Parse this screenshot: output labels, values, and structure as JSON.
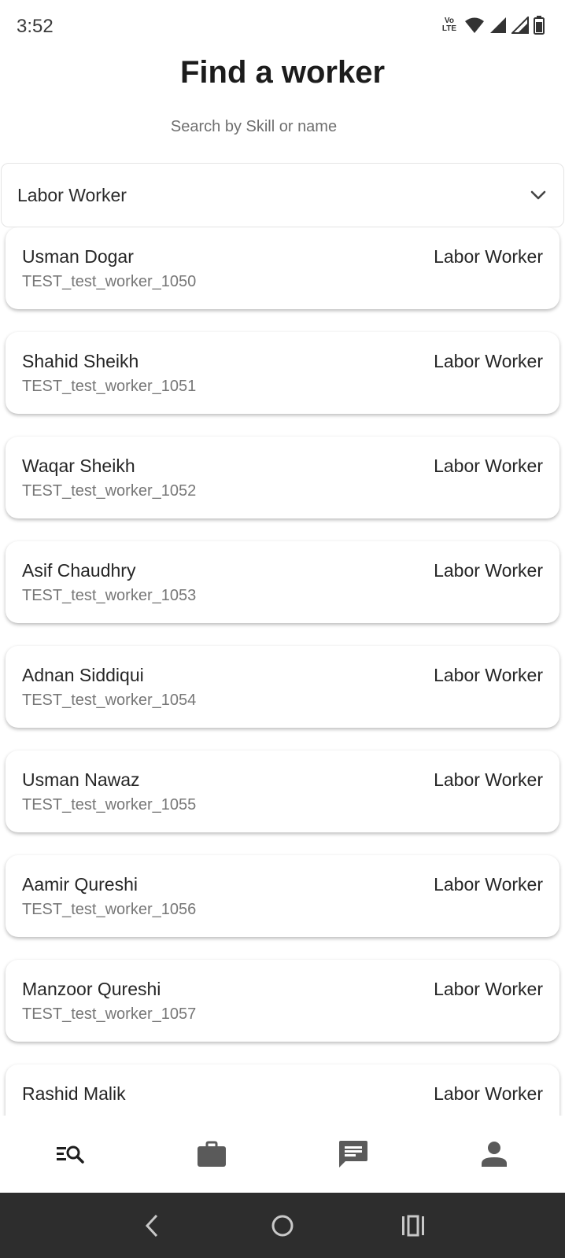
{
  "status_bar": {
    "time": "3:52",
    "volte_top": "Vo",
    "volte_bottom": "LTE",
    "icons": [
      "volte-icon",
      "wifi-icon",
      "signal-icon",
      "signal-icon",
      "battery-icon"
    ]
  },
  "header": {
    "title": "Find a worker",
    "search_hint": "Search by Skill or name"
  },
  "filter": {
    "selected": "Labor Worker",
    "icon": "chevron-down-icon"
  },
  "workers": [
    {
      "name": "Usman Dogar",
      "id": "TEST_test_worker_1050",
      "skill": "Labor Worker"
    },
    {
      "name": "Shahid Sheikh",
      "id": "TEST_test_worker_1051",
      "skill": "Labor Worker"
    },
    {
      "name": "Waqar Sheikh",
      "id": "TEST_test_worker_1052",
      "skill": "Labor Worker"
    },
    {
      "name": "Asif Chaudhry",
      "id": "TEST_test_worker_1053",
      "skill": "Labor Worker"
    },
    {
      "name": "Adnan Siddiqui",
      "id": "TEST_test_worker_1054",
      "skill": "Labor Worker"
    },
    {
      "name": "Usman Nawaz",
      "id": "TEST_test_worker_1055",
      "skill": "Labor Worker"
    },
    {
      "name": "Aamir Qureshi",
      "id": "TEST_test_worker_1056",
      "skill": "Labor Worker"
    },
    {
      "name": "Manzoor Qureshi",
      "id": "TEST_test_worker_1057",
      "skill": "Labor Worker"
    },
    {
      "name": "Rashid Malik",
      "id": "",
      "skill": "Labor Worker"
    }
  ],
  "bottom_nav": {
    "items": [
      {
        "icon": "search-list-icon",
        "active": true
      },
      {
        "icon": "briefcase-icon",
        "active": false
      },
      {
        "icon": "chat-icon",
        "active": false
      },
      {
        "icon": "person-icon",
        "active": false
      }
    ]
  },
  "colors": {
    "active_icon": "#1e1e1e",
    "inactive_icon": "#5a5a5a",
    "system_nav_bg": "#2d2d2d"
  }
}
